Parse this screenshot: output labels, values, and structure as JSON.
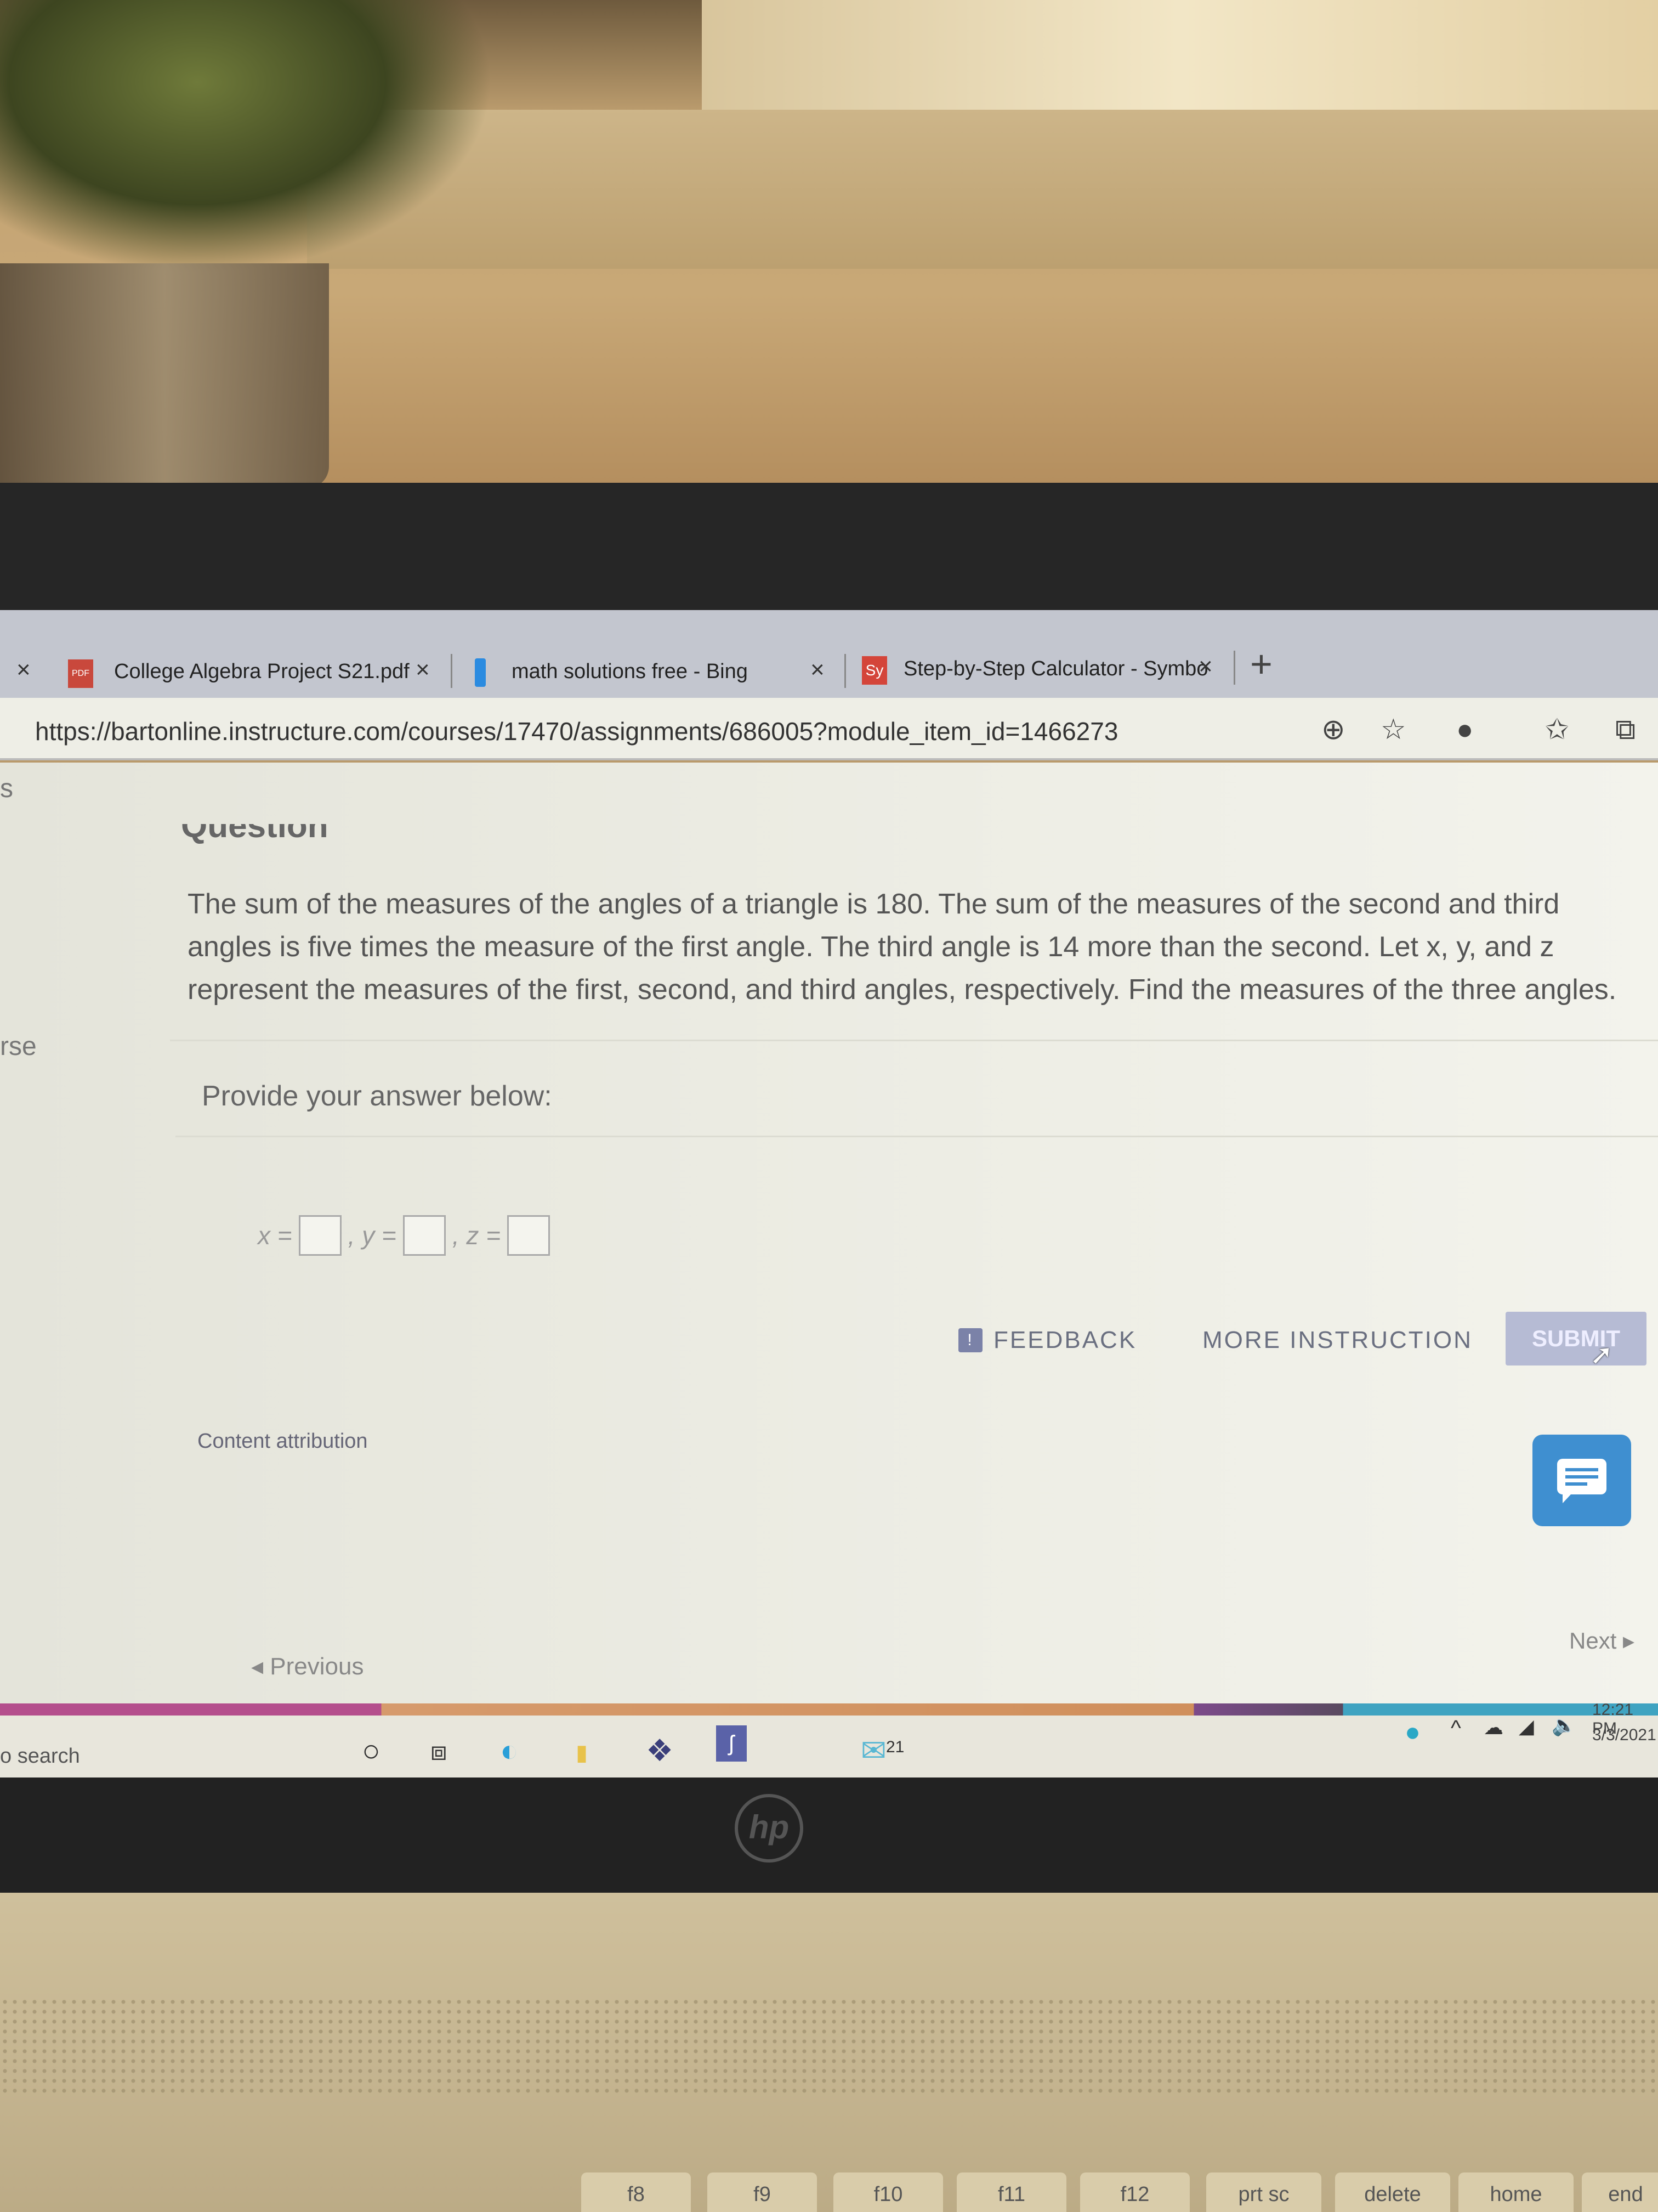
{
  "browser": {
    "tabs": [
      {
        "label": "College Algebra Project S21.pdf",
        "icon": "pdf-icon",
        "icon_text": "PDF"
      },
      {
        "label": "math solutions free - Bing",
        "icon": "bing-icon"
      },
      {
        "label": "Step-by-Step Calculator - Symbo",
        "icon": "symbolab-icon",
        "icon_text": "Sy"
      }
    ],
    "close_glyph": "×",
    "new_tab_glyph": "+",
    "url": "https://bartonline.instructure.com/courses/17470/assignments/686005?module_item_id=1466273"
  },
  "sidebar": {
    "fragment_top": "s",
    "fragment_mid": "rse"
  },
  "question": {
    "heading": "Question",
    "lines": [
      "The sum of the measures of the angles of a triangle is 180. The sum of the measures of the second and third",
      "angles is five times the measure of the first angle. The third angle is 14 more than the second. Let x, y, and z",
      "represent the measures of the first, second, and third angles, respectively. Find the measures of the three angles."
    ],
    "prompt": "Provide your answer below:",
    "answers": [
      {
        "label": "x =",
        "value": ""
      },
      {
        "label": ", y =",
        "value": ""
      },
      {
        "label": ", z =",
        "value": ""
      }
    ]
  },
  "actions": {
    "feedback": "FEEDBACK",
    "more_instruction": "MORE INSTRUCTION",
    "submit": "SUBMIT"
  },
  "footer": {
    "content_attribution": "Content attribution",
    "previous": "◂ Previous",
    "next": "Next ▸"
  },
  "taskbar": {
    "search": "o search",
    "mail_badge": "21",
    "time": "12:21 PM",
    "date": "3/3/2021"
  },
  "laptop": {
    "logo": "hp"
  },
  "keyboard": {
    "keys": [
      "f8",
      "f9",
      "f10",
      "f11",
      "f12",
      "prt sc",
      "delete",
      "home",
      "end"
    ]
  },
  "colors": {
    "submit": "#b6bbd4",
    "chat": "#3f8fd0",
    "feedback_icon": "#7b82a8"
  }
}
